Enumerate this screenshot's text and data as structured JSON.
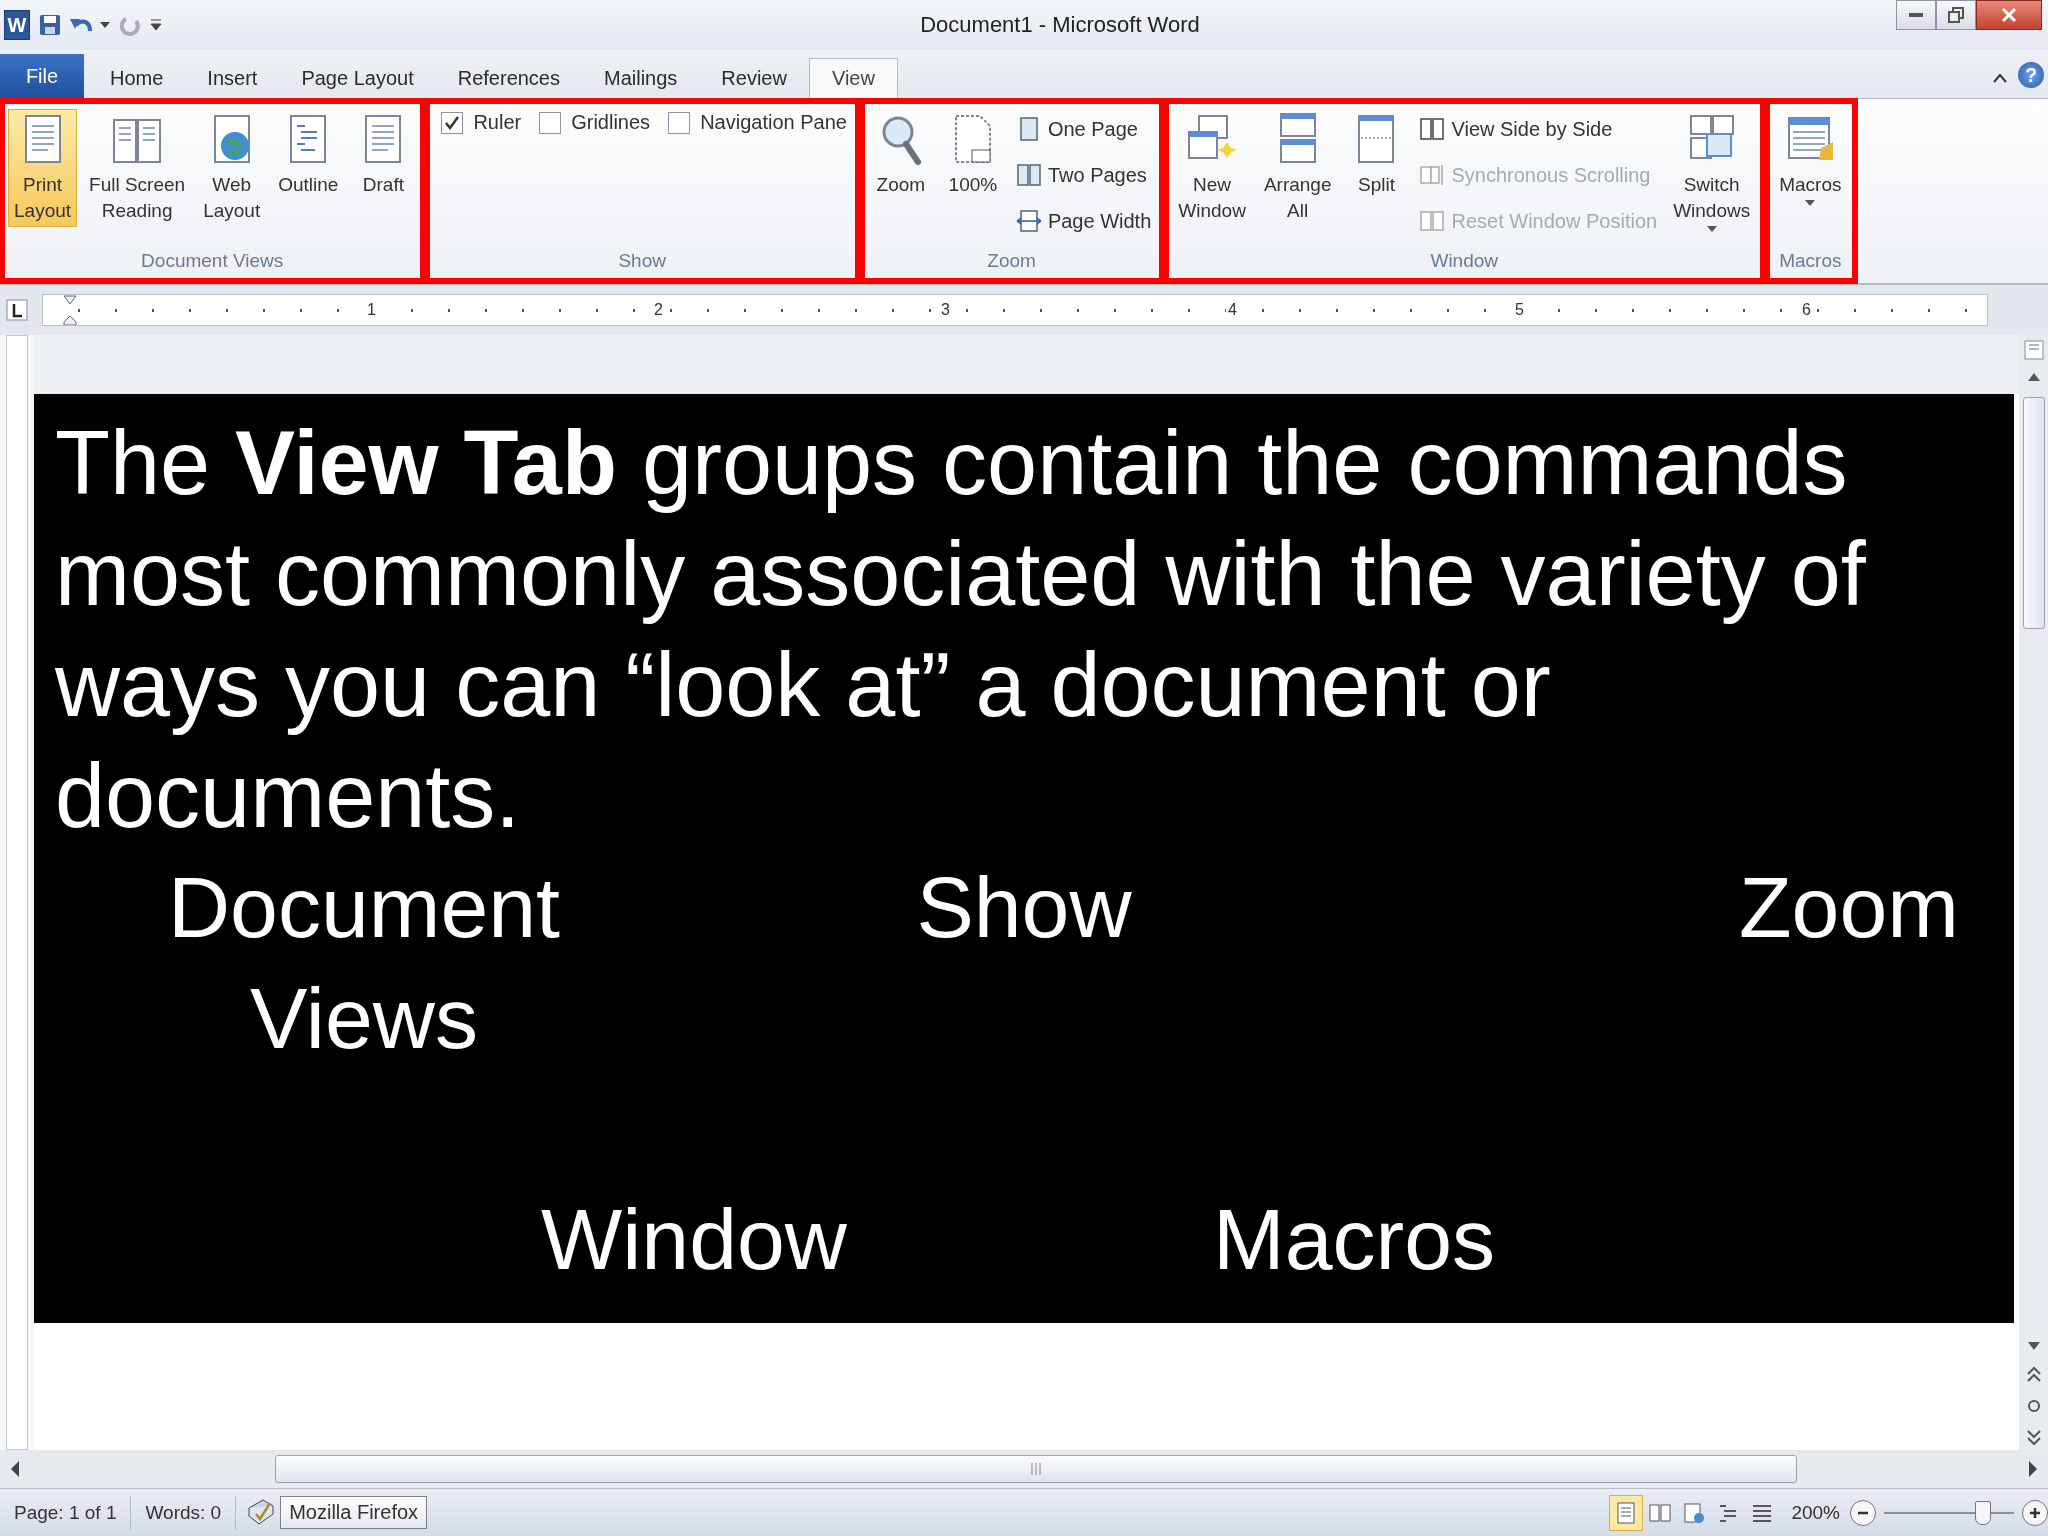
{
  "window": {
    "app_icon": "W",
    "title": "Document1 - Microsoft Word"
  },
  "tabs": [
    {
      "label": "File",
      "kind": "file",
      "selected": false
    },
    {
      "label": "Home",
      "kind": "tab",
      "selected": false
    },
    {
      "label": "Insert",
      "kind": "tab",
      "selected": false
    },
    {
      "label": "Page Layout",
      "kind": "tab",
      "selected": false
    },
    {
      "label": "References",
      "kind": "tab",
      "selected": false
    },
    {
      "label": "Mailings",
      "kind": "tab",
      "selected": false
    },
    {
      "label": "Review",
      "kind": "tab",
      "selected": false
    },
    {
      "label": "View",
      "kind": "tab",
      "selected": true
    }
  ],
  "help": "?",
  "ribbon": {
    "groups": [
      {
        "label": "Document Views",
        "highlighted": true,
        "items": [
          {
            "kind": "large",
            "label": "Print\nLayout",
            "selected": true
          },
          {
            "kind": "large",
            "label": "Full Screen\nReading",
            "selected": false
          },
          {
            "kind": "large",
            "label": "Web\nLayout",
            "selected": false
          },
          {
            "kind": "large",
            "label": "Outline",
            "selected": false
          },
          {
            "kind": "large",
            "label": "Draft",
            "selected": false
          }
        ]
      },
      {
        "label": "Show",
        "highlighted": true,
        "items": [
          {
            "kind": "check",
            "label": "Ruler",
            "checked": true
          },
          {
            "kind": "check",
            "label": "Gridlines",
            "checked": false
          },
          {
            "kind": "check",
            "label": "Navigation Pane",
            "checked": false
          }
        ]
      },
      {
        "label": "Zoom",
        "highlighted": true,
        "items": [
          {
            "kind": "large",
            "label": "Zoom"
          },
          {
            "kind": "large",
            "label": "100%"
          },
          {
            "kind": "small",
            "label": "One Page",
            "disabled": false
          },
          {
            "kind": "small",
            "label": "Two Pages",
            "disabled": false
          },
          {
            "kind": "small",
            "label": "Page Width",
            "disabled": false
          }
        ]
      },
      {
        "label": "Window",
        "highlighted": true,
        "items": [
          {
            "kind": "large",
            "label": "New\nWindow"
          },
          {
            "kind": "large",
            "label": "Arrange\nAll"
          },
          {
            "kind": "large",
            "label": "Split"
          },
          {
            "kind": "small",
            "label": "View Side by Side",
            "disabled": false
          },
          {
            "kind": "small",
            "label": "Synchronous Scrolling",
            "disabled": true
          },
          {
            "kind": "small",
            "label": "Reset Window Position",
            "disabled": true
          },
          {
            "kind": "large",
            "label": "Switch\nWindows",
            "dropdown": true
          }
        ]
      },
      {
        "label": "Macros",
        "highlighted": true,
        "items": [
          {
            "kind": "large",
            "label": "Macros",
            "dropdown": true
          }
        ]
      }
    ]
  },
  "ruler": {
    "labels": [
      "1",
      "2",
      "3",
      "4",
      "5",
      "6"
    ]
  },
  "slide": {
    "text": "The **View Tab** groups contain the commands most commonly associated with the variety of ways you can “look at” a document or documents.",
    "labels": [
      "Document\nViews",
      "Show",
      "Zoom",
      "Window",
      "Macros"
    ]
  },
  "status_bar": {
    "page": "Page: 1 of 1",
    "words": "Words: 0",
    "tooltip": "Mozilla Firefox",
    "views": [
      {
        "selected": true
      },
      {
        "selected": false
      },
      {
        "selected": false
      },
      {
        "selected": false
      },
      {
        "selected": false
      }
    ],
    "zoom": "200%",
    "zoom_slider": {
      "level": 0.75
    }
  }
}
